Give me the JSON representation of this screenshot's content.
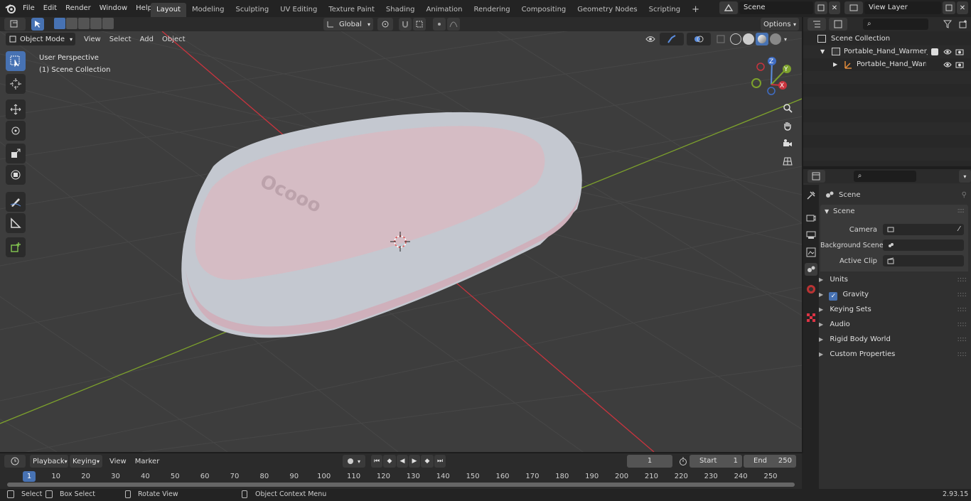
{
  "topbar": {
    "menus": [
      "File",
      "Edit",
      "Render",
      "Window",
      "Help"
    ],
    "workspaces": [
      "Layout",
      "Modeling",
      "Sculpting",
      "UV Editing",
      "Texture Paint",
      "Shading",
      "Animation",
      "Rendering",
      "Compositing",
      "Geometry Nodes",
      "Scripting"
    ],
    "active_workspace": "Layout",
    "scene_name": "Scene",
    "view_layer": "View Layer"
  },
  "viewport_header": {
    "mode": "Object Mode",
    "menus": [
      "View",
      "Select",
      "Add",
      "Object"
    ],
    "orientation": "Global",
    "options_label": "Options"
  },
  "viewport_overlay": {
    "perspective": "User Perspective",
    "collection": "(1) Scene Collection",
    "axes": {
      "z": "Z",
      "y": "Y",
      "x": "X"
    }
  },
  "model": {
    "body_color": "#c4c8d0",
    "top_color": "#d5bcc4",
    "stripe_color": "#cfb0bb",
    "logo_text": "Ocooo"
  },
  "outliner": {
    "root": "Scene Collection",
    "items": [
      {
        "label": "Portable_Hand_Warmer_Ococ"
      },
      {
        "label": "Portable_Hand_Warmer_("
      }
    ]
  },
  "properties": {
    "context_title": "Scene",
    "panel_title": "Scene",
    "fields": [
      {
        "label": "Camera"
      },
      {
        "label": "Background Scene"
      },
      {
        "label": "Active Clip"
      }
    ],
    "panels": [
      {
        "label": "Units",
        "checkbox": false
      },
      {
        "label": "Gravity",
        "checkbox": true
      },
      {
        "label": "Keying Sets",
        "checkbox": false
      },
      {
        "label": "Audio",
        "checkbox": false
      },
      {
        "label": "Rigid Body World",
        "checkbox": false
      },
      {
        "label": "Custom Properties",
        "checkbox": false
      }
    ]
  },
  "timeline": {
    "menus": [
      "Playback",
      "Keying",
      "View",
      "Marker"
    ],
    "current_frame": "1",
    "start_label": "Start",
    "start_value": "1",
    "end_label": "End",
    "end_value": "250",
    "ticks": [
      10,
      20,
      30,
      40,
      50,
      60,
      70,
      80,
      90,
      100,
      110,
      120,
      130,
      140,
      150,
      160,
      170,
      180,
      190,
      200,
      210,
      220,
      230,
      240,
      250
    ],
    "playhead_label": "1"
  },
  "statusbar": {
    "select": "Select",
    "box_select": "Box Select",
    "rotate_view": "Rotate View",
    "context_menu": "Object Context Menu",
    "version": "2.93.15"
  },
  "colors": {
    "accent": "#4772b3",
    "x_axis": "#c9343e",
    "y_axis": "#7da12c"
  }
}
